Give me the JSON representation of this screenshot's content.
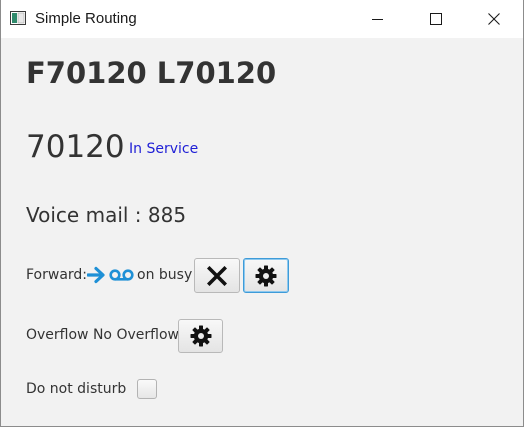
{
  "window": {
    "title": "Simple Routing",
    "controls": [
      "minimize",
      "maximize",
      "close"
    ]
  },
  "user": {
    "name": "F70120 L70120",
    "number": "70120",
    "status": "In Service",
    "status_color": "#1f1fd6",
    "voicemail_label": "Voice mail : 885"
  },
  "forward": {
    "label": "Forward:",
    "target_icons": [
      "arrow-right-icon",
      "voicemail-icon"
    ],
    "condition": "on busy",
    "accent_color": "#1e90d6",
    "clear_icon": "close-x-icon",
    "settings_icon": "gear-icon"
  },
  "overflow": {
    "label": "Overflow No Overflow",
    "settings_icon": "gear-icon"
  },
  "dnd": {
    "label": "Do not disturb",
    "checked": false
  }
}
